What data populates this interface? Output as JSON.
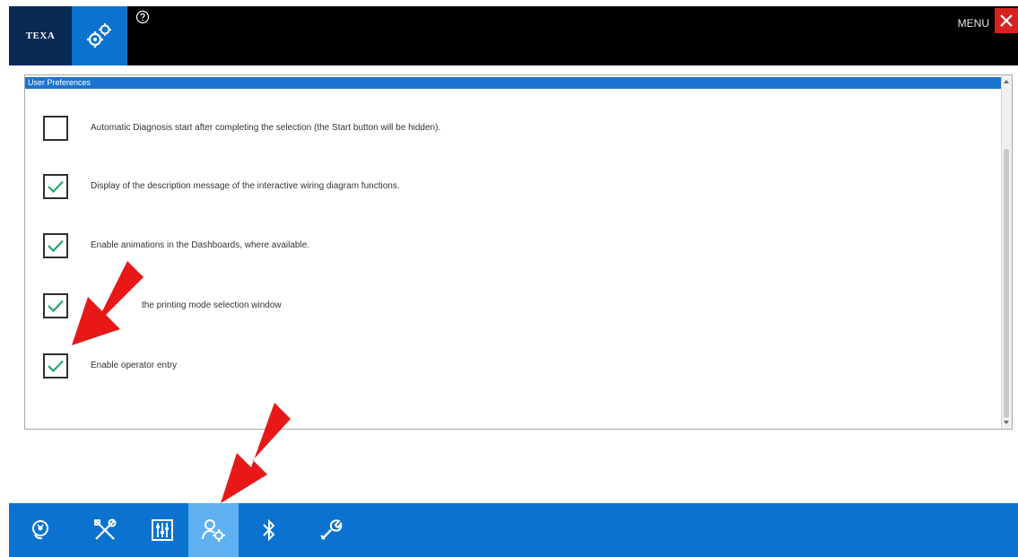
{
  "header": {
    "logo_text": "TEXA",
    "menu_label": "MENU",
    "icons": {
      "settings": "gears-icon",
      "help": "help-icon",
      "close": "close-icon"
    }
  },
  "panel": {
    "title": "User Preferences",
    "items": [
      {
        "label": "Automatic Diagnosis start after completing the selection (the Start button will be hidden).",
        "checked": false
      },
      {
        "label": "Display of the description message of the interactive wiring diagram functions.",
        "checked": true
      },
      {
        "label": "Enable animations in the Dashboards, where available.",
        "checked": true
      },
      {
        "label": "the printing mode selection window",
        "checked": true
      },
      {
        "label": "Enable operator entry",
        "checked": true
      }
    ]
  },
  "toolbar": {
    "tools": [
      {
        "name": "diagnosis-tool",
        "icon": "diagnosis-icon",
        "active": false
      },
      {
        "name": "tools-tool",
        "icon": "wrench-screwdriver-icon",
        "active": false
      },
      {
        "name": "adjustments-tool",
        "icon": "sliders-icon",
        "active": false
      },
      {
        "name": "user-settings-tool",
        "icon": "user-gear-icon",
        "active": true
      },
      {
        "name": "bluetooth-tool",
        "icon": "bluetooth-icon",
        "active": false
      },
      {
        "name": "service-tool",
        "icon": "wrench-icon",
        "active": false
      }
    ]
  },
  "colors": {
    "primary_blue": "#0b72d0",
    "active_tab": "#5fb0f0",
    "check_green": "#2aa86c",
    "close_red": "#d9221d",
    "annotation_red": "#e81818"
  }
}
